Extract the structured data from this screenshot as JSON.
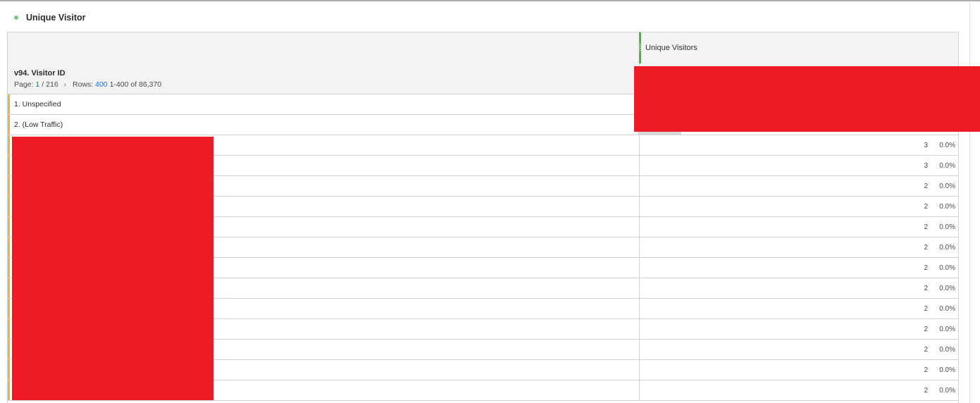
{
  "panel": {
    "title": "Unique Visitor"
  },
  "table": {
    "metric_header": "Unique Visitors",
    "dimension": {
      "name": "v94. Visitor ID",
      "page_label": "Page:",
      "page_current": "1",
      "page_total": "216",
      "rows_label": "Rows:",
      "rows_value": "400",
      "range": "1-400 of 86,370"
    },
    "rows": [
      {
        "label": "1. Unspecified",
        "value": "",
        "pct": ""
      },
      {
        "label": "2. (Low Traffic)",
        "value": "",
        "pct": ""
      },
      {
        "label": "",
        "value": "3",
        "pct": "0.0%"
      },
      {
        "label": "",
        "value": "3",
        "pct": "0.0%"
      },
      {
        "label": "",
        "value": "2",
        "pct": "0.0%"
      },
      {
        "label": "",
        "value": "2",
        "pct": "0.0%"
      },
      {
        "label": "",
        "value": "2",
        "pct": "0.0%"
      },
      {
        "label": "",
        "value": "2",
        "pct": "0.0%"
      },
      {
        "label": "",
        "value": "2",
        "pct": "0.0%"
      },
      {
        "label": "",
        "value": "2",
        "pct": "0.0%"
      },
      {
        "label": "",
        "value": "2",
        "pct": "0.0%"
      },
      {
        "label": "",
        "value": "2",
        "pct": "0.0%"
      },
      {
        "label": "",
        "value": "2",
        "pct": "0.0%"
      },
      {
        "label": "",
        "value": "2",
        "pct": "0.0%"
      },
      {
        "label": "",
        "value": "2",
        "pct": "0.0%"
      }
    ]
  },
  "colors": {
    "accent_green": "#44b556",
    "row_accent": "#e8b54a",
    "link_blue": "#1473e6",
    "redaction": "#ed1c24"
  }
}
